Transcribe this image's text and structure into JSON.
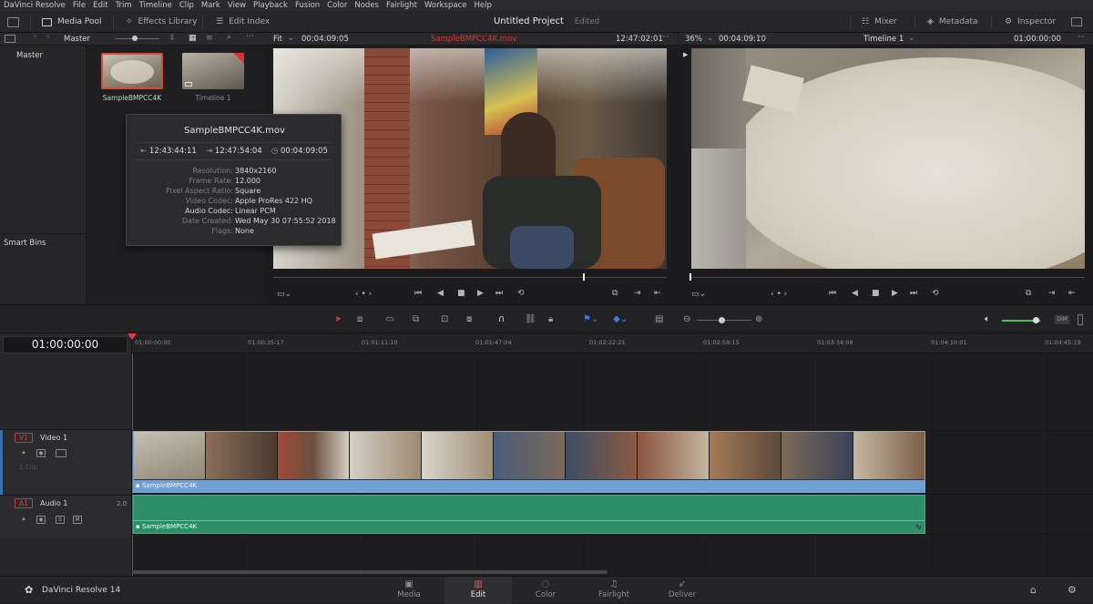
{
  "menu": [
    "DaVinci Resolve",
    "File",
    "Edit",
    "Trim",
    "Timeline",
    "Clip",
    "Mark",
    "View",
    "Playback",
    "Fusion",
    "Color",
    "Nodes",
    "Fairlight",
    "Workspace",
    "Help"
  ],
  "toolbar": {
    "media_pool": "Media Pool",
    "effects_library": "Effects Library",
    "edit_index": "Edit Index",
    "project_title": "Untitled Project",
    "project_state": "Edited",
    "mixer": "Mixer",
    "metadata": "Metadata",
    "inspector": "Inspector"
  },
  "pool": {
    "bin_name": "Master",
    "bins": [
      "Master"
    ],
    "smart_bins": "Smart Bins",
    "clips": [
      {
        "name": "SampleBMPCC4K"
      },
      {
        "name": "Timeline 1"
      }
    ]
  },
  "clip_info": {
    "filename": "SampleBMPCC4K.mov",
    "tc_in": "12:43:44:11",
    "tc_out": "12:47:54:04",
    "duration": "00:04:09:05",
    "fields": [
      {
        "key": "Resolution:",
        "value": "3840x2160"
      },
      {
        "key": "Frame Rate:",
        "value": "12.000"
      },
      {
        "key": "Pixel Aspect Ratio:",
        "value": "Square"
      },
      {
        "key": "Video Codec:",
        "value": "Apple ProRes 422 HQ"
      },
      {
        "key": "Audio Codec:",
        "value": "Linear PCM"
      },
      {
        "key": "Date Created:",
        "value": "Wed May 30 07:55:52 2018"
      },
      {
        "key": "Flags:",
        "value": "None"
      }
    ]
  },
  "source_viewer": {
    "zoom": "Fit",
    "duration": "00:04:09:05",
    "clip_name": "SampleBMPCC4K.mov",
    "timecode": "12:47:02:01",
    "accent": "#d13b3b"
  },
  "timeline_viewer": {
    "zoom": "36%",
    "duration": "00:04:09:10",
    "timeline_name": "Timeline 1",
    "timecode": "01:00:00:00"
  },
  "timeline": {
    "current_tc": "01:00:00:00",
    "ruler": [
      "01:00:00:00",
      "01:00:35:17",
      "01:01:11:10",
      "01:01:47:04",
      "01:02:22:21",
      "01:02:58:15",
      "01:03:34:08",
      "01:04:10:01",
      "01:04:45:19"
    ],
    "tracks": {
      "video": {
        "badge": "V1",
        "name": "Video 1",
        "clips": "1 Clip"
      },
      "audio": {
        "badge": "A1",
        "name": "Audio 1",
        "channels": "2.0",
        "solo": "S",
        "mute": "M"
      }
    },
    "video_clip_label": "SampleBMPCC4K",
    "audio_clip_label": "SampleBMPCC4K",
    "video_color": "#6f9fd3",
    "audio_color": "#2c8f6a",
    "dim_label": "DIM"
  },
  "pages": {
    "app_name": "DaVinci Resolve 14",
    "items": [
      "Media",
      "Edit",
      "Color",
      "Fairlight",
      "Deliver"
    ],
    "active": "Edit"
  }
}
